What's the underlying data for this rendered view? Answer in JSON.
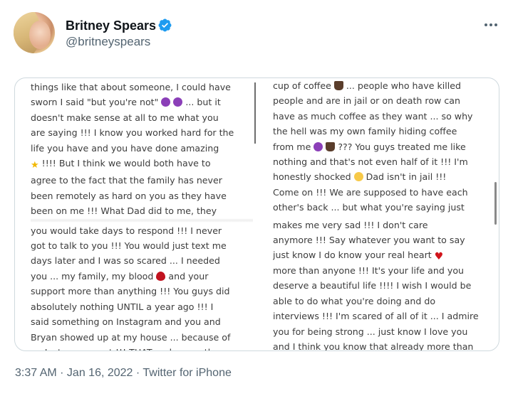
{
  "tweet": {
    "author_name": "Britney Spears",
    "author_handle": "@britneyspears",
    "timestamp": "3:37 AM · Jan 16, 2022 · Twitter for iPhone",
    "more_icon": "ellipsis-icon",
    "verified_color": "#1d9bf0"
  },
  "image_text": {
    "left_lines": [
      "things like that about someone, I could have",
      "sworn I said \"but you're not\" [e] [e] ... but it",
      "doesn't make sense at all to me what you",
      "are saying !!! I know you worked hard for the",
      "life you have and you have done amazing",
      "[star] !!!! But I think we would both have to",
      "agree to the fact that the family has never",
      "been remotely as hard on you as they have",
      "been on me !!! What Dad did to me, they",
      "you would take days to respond !!! I never",
      "got to talk to you !!! You would just text me",
      "days later and I was so scared ... I needed",
      "you ... my family, my blood [drop] and your",
      "support more than anything !!! You guys did",
      "absolutely nothing UNTIL a year ago !!! I",
      "said something on Instagram and you and",
      "Bryan showed up at my house ... because of",
      "an Instagram post !!! THAT makes me the"
    ],
    "right_lines": [
      "cup of coffee [cup] ... people who have killed",
      "people and are in jail or on death row can",
      "have as much coffee as they want ... so why",
      "the hell was my own family hiding coffee",
      "from me [e] [cup] ??? You guys treated me like",
      "nothing and that's not even half of it !!! I'm",
      "honestly shocked [shock] Dad isn't in jail !!!",
      "Come on !!! We are supposed to have each",
      "other's back ... but what you're saying just",
      "makes me very sad !!! I don't care",
      "anymore !!! Say whatever you want to say",
      "just know I do know your real heart [heart]",
      "more than anyone !!! It's your life and you",
      "deserve a beautiful life !!!! I wish I would be",
      "able to do what you're doing and do",
      "interviews !!! I'm scared of all of it ... I admire",
      "you for being strong ... just know I love you",
      "and I think you know that already more than"
    ]
  }
}
